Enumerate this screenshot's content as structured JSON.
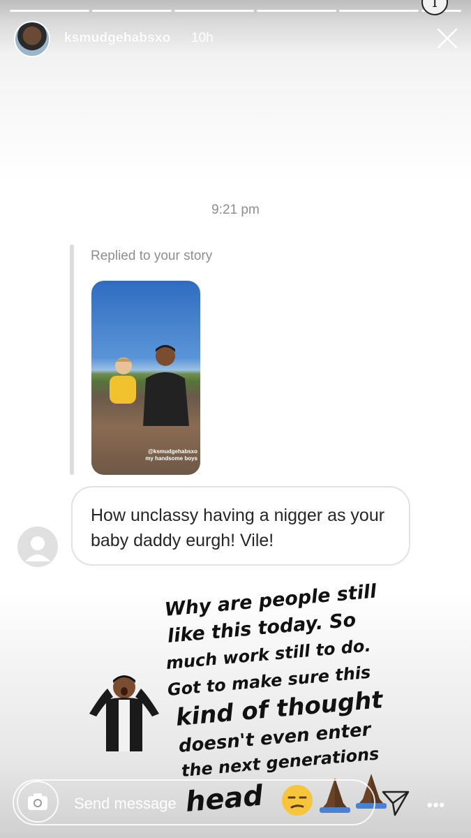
{
  "story": {
    "progress_segments": 6,
    "username": "ksmudgehabsxo",
    "posted_ago": "10h",
    "info_glyph": "i"
  },
  "conversation": {
    "timestamp": "9:21 pm",
    "replied_label": "Replied to your story",
    "story_thumbnail_caption": "@ksmudgehabsxo my handsome boys",
    "message_text": "How unclassy having a nigger as your baby daddy eurgh!  Vile!"
  },
  "overlay": {
    "lines": [
      "Why are people still",
      "like this today. So",
      "much work still to do.",
      "Got to make sure this",
      "kind of thought",
      "doesn't even enter",
      "the next generations",
      "head"
    ],
    "emojis": [
      "unamused-face",
      "folded-hands",
      "folded-hands"
    ]
  },
  "footer": {
    "send_placeholder": "Send message"
  },
  "icons": {
    "close": "close-icon",
    "camera": "camera-icon",
    "direct": "paper-plane-icon",
    "more": "more-icon"
  }
}
